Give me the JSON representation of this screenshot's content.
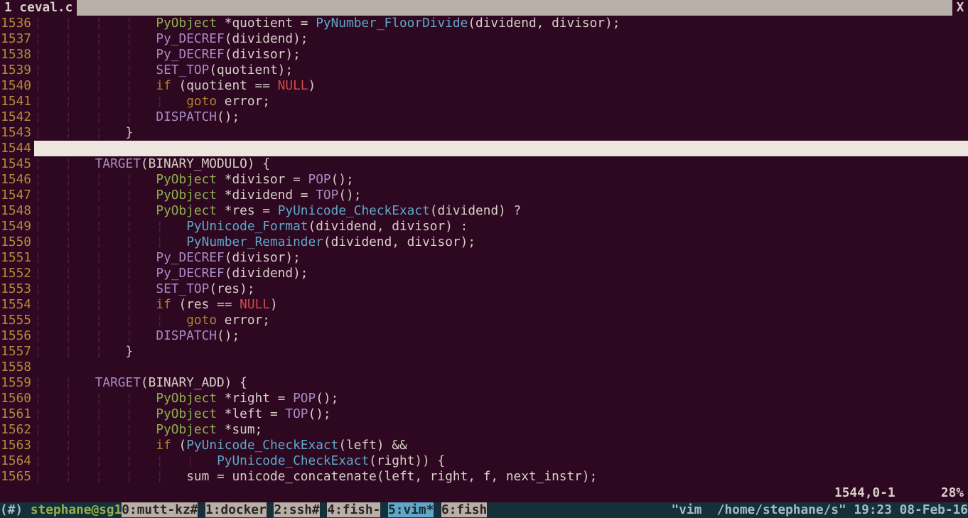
{
  "tabline": {
    "active_tab": " 1 ceval.c ",
    "close_btn": "X"
  },
  "code": {
    "lines": [
      {
        "n": 1536,
        "ind": 4,
        "segs": [
          [
            "type",
            "PyObject"
          ],
          [
            "text",
            " *quotient = "
          ],
          [
            "call",
            "PyNumber_FloorDivide"
          ],
          [
            "text",
            "(dividend, divisor);"
          ]
        ]
      },
      {
        "n": 1537,
        "ind": 4,
        "segs": [
          [
            "func",
            "Py_DECREF"
          ],
          [
            "text",
            "(dividend);"
          ]
        ]
      },
      {
        "n": 1538,
        "ind": 4,
        "segs": [
          [
            "func",
            "Py_DECREF"
          ],
          [
            "text",
            "(divisor);"
          ]
        ]
      },
      {
        "n": 1539,
        "ind": 4,
        "segs": [
          [
            "func",
            "SET_TOP"
          ],
          [
            "text",
            "(quotient);"
          ]
        ]
      },
      {
        "n": 1540,
        "ind": 4,
        "segs": [
          [
            "kw",
            "if"
          ],
          [
            "text",
            " (quotient == "
          ],
          [
            "null",
            "NULL"
          ],
          [
            "text",
            ")"
          ]
        ]
      },
      {
        "n": 1541,
        "ind": 5,
        "segs": [
          [
            "kw",
            "goto"
          ],
          [
            "text",
            " error;"
          ]
        ]
      },
      {
        "n": 1542,
        "ind": 4,
        "segs": [
          [
            "func",
            "DISPATCH"
          ],
          [
            "text",
            "();"
          ]
        ]
      },
      {
        "n": 1543,
        "ind": 3,
        "segs": [
          [
            "text",
            "}"
          ]
        ]
      },
      {
        "n": 1544,
        "cursor": true
      },
      {
        "n": 1545,
        "ind": 2,
        "segs": [
          [
            "func",
            "TARGET"
          ],
          [
            "text",
            "(BINARY_MODULO) {"
          ]
        ]
      },
      {
        "n": 1546,
        "ind": 4,
        "segs": [
          [
            "type",
            "PyObject"
          ],
          [
            "text",
            " *divisor = "
          ],
          [
            "func",
            "POP"
          ],
          [
            "text",
            "();"
          ]
        ]
      },
      {
        "n": 1547,
        "ind": 4,
        "segs": [
          [
            "type",
            "PyObject"
          ],
          [
            "text",
            " *dividend = "
          ],
          [
            "func",
            "TOP"
          ],
          [
            "text",
            "();"
          ]
        ]
      },
      {
        "n": 1548,
        "ind": 4,
        "segs": [
          [
            "type",
            "PyObject"
          ],
          [
            "text",
            " *res = "
          ],
          [
            "call",
            "PyUnicode_CheckExact"
          ],
          [
            "text",
            "(dividend) ?"
          ]
        ]
      },
      {
        "n": 1549,
        "ind": 5,
        "segs": [
          [
            "call",
            "PyUnicode_Format"
          ],
          [
            "text",
            "(dividend, divisor) :"
          ]
        ]
      },
      {
        "n": 1550,
        "ind": 5,
        "segs": [
          [
            "call",
            "PyNumber_Remainder"
          ],
          [
            "text",
            "(dividend, divisor);"
          ]
        ]
      },
      {
        "n": 1551,
        "ind": 4,
        "segs": [
          [
            "func",
            "Py_DECREF"
          ],
          [
            "text",
            "(divisor);"
          ]
        ]
      },
      {
        "n": 1552,
        "ind": 4,
        "segs": [
          [
            "func",
            "Py_DECREF"
          ],
          [
            "text",
            "(dividend);"
          ]
        ]
      },
      {
        "n": 1553,
        "ind": 4,
        "segs": [
          [
            "func",
            "SET_TOP"
          ],
          [
            "text",
            "(res);"
          ]
        ]
      },
      {
        "n": 1554,
        "ind": 4,
        "segs": [
          [
            "kw",
            "if"
          ],
          [
            "text",
            " (res == "
          ],
          [
            "null",
            "NULL"
          ],
          [
            "text",
            ")"
          ]
        ]
      },
      {
        "n": 1555,
        "ind": 5,
        "segs": [
          [
            "kw",
            "goto"
          ],
          [
            "text",
            " error;"
          ]
        ]
      },
      {
        "n": 1556,
        "ind": 4,
        "segs": [
          [
            "func",
            "DISPATCH"
          ],
          [
            "text",
            "();"
          ]
        ]
      },
      {
        "n": 1557,
        "ind": 3,
        "segs": [
          [
            "text",
            "}"
          ]
        ]
      },
      {
        "n": 1558,
        "ind": 0,
        "segs": []
      },
      {
        "n": 1559,
        "ind": 2,
        "segs": [
          [
            "func",
            "TARGET"
          ],
          [
            "text",
            "(BINARY_ADD) {"
          ]
        ]
      },
      {
        "n": 1560,
        "ind": 4,
        "segs": [
          [
            "type",
            "PyObject"
          ],
          [
            "text",
            " *right = "
          ],
          [
            "func",
            "POP"
          ],
          [
            "text",
            "();"
          ]
        ]
      },
      {
        "n": 1561,
        "ind": 4,
        "segs": [
          [
            "type",
            "PyObject"
          ],
          [
            "text",
            " *left = "
          ],
          [
            "func",
            "TOP"
          ],
          [
            "text",
            "();"
          ]
        ]
      },
      {
        "n": 1562,
        "ind": 4,
        "segs": [
          [
            "type",
            "PyObject"
          ],
          [
            "text",
            " *sum;"
          ]
        ]
      },
      {
        "n": 1563,
        "ind": 4,
        "segs": [
          [
            "kw",
            "if"
          ],
          [
            "text",
            " ("
          ],
          [
            "call",
            "PyUnicode_CheckExact"
          ],
          [
            "text",
            "(left) &&"
          ]
        ]
      },
      {
        "n": 1564,
        "ind": 6,
        "segs": [
          [
            "call",
            "PyUnicode_CheckExact"
          ],
          [
            "text",
            "(right)) {"
          ]
        ]
      },
      {
        "n": 1565,
        "ind": 5,
        "segs": [
          [
            "text",
            "sum = unicode_concatenate(left, right, f, next_instr);"
          ]
        ]
      }
    ]
  },
  "ruler": "1544,0-1      28%",
  "status": {
    "prefix": "(#) ",
    "user": "stephane@sg1",
    "windows": [
      {
        "label": "0:mutt-kz#",
        "active": false
      },
      {
        "label": "1:docker",
        "active": false
      },
      {
        "label": "2:ssh#",
        "active": false
      },
      {
        "label": "4:fish-",
        "active": false
      },
      {
        "label": "5:vim*",
        "active": true
      },
      {
        "label": "6:fish",
        "active": false
      }
    ],
    "right": "\"vim  /home/stephane/s\" 19:23 08-Feb-16"
  }
}
